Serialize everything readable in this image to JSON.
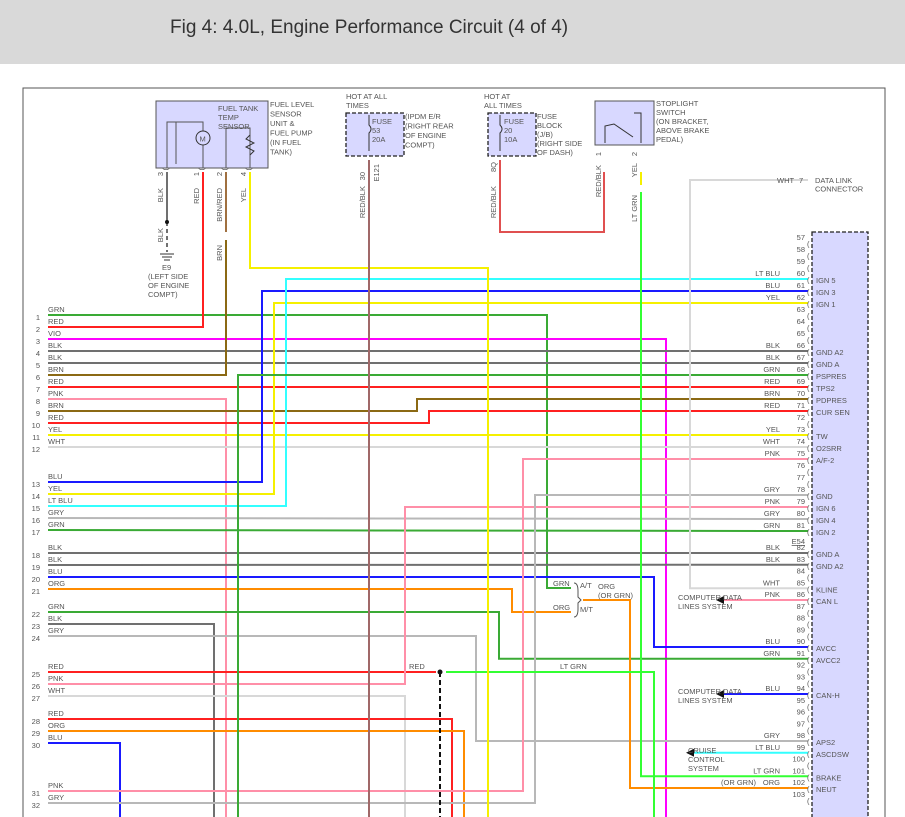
{
  "title": "Fig 4: 4.0L, Engine Performance Circuit (4 of 4)",
  "colors": {
    "GRN": "#3aaa35",
    "RED": "#ff2020",
    "VIO": "#ff00ff",
    "BLK": "#707070",
    "BRN": "#8b6914",
    "PNK": "#ff8fa8",
    "YEL": "#f5f000",
    "WHT": "#d8d8d8",
    "BLU": "#1a1aff",
    "LT BLU": "#33ffff",
    "GRY": "#b8b8b8",
    "ORG": "#ff8c00",
    "LT GRN": "#33ff33",
    "RED/BLK": "#a06868",
    "component_fill": "#d8d8ff"
  },
  "fuel_sensor": {
    "inner_label": [
      "FUEL TANK",
      "TEMP",
      "SENSOR"
    ],
    "label": [
      "FUEL LEVEL",
      "SENSOR",
      "UNIT &",
      "FUEL PUMP",
      "(IN FUEL",
      "TANK)"
    ],
    "motor_symbol": "M",
    "pins": [
      {
        "num": "3",
        "wire": "BLK"
      },
      {
        "num": "1",
        "wire": "RED"
      },
      {
        "num": "2",
        "wire": "BRN/RED"
      },
      {
        "num": "4",
        "wire": "YEL"
      }
    ],
    "brn_after_connector": "BRN",
    "blk_after_splice": "BLK",
    "ground_id": "E9",
    "ground_label": [
      "(LEFT SIDE",
      "OF ENGINE",
      "COMPT)"
    ]
  },
  "fuse53": {
    "hot": [
      "HOT AT ALL",
      "TIMES"
    ],
    "fuse": [
      "FUSE",
      "53",
      "20A"
    ],
    "label": [
      "(IPDM E/R",
      "(RIGHT REAR",
      "OF ENGINE",
      "COMPT)"
    ],
    "pin": "30",
    "wire": "RED/BLK",
    "connector": "E121"
  },
  "fuse20": {
    "hot": [
      "HOT AT",
      "ALL TIMES"
    ],
    "fuse": [
      "FUSE",
      "20",
      "10A"
    ],
    "label": [
      "FUSE",
      "BLOCK",
      "(J/B)",
      "(RIGHT SIDE",
      "OF DASH)"
    ],
    "pin": "8Q",
    "wire": "RED/BLK"
  },
  "stoplight": {
    "label": [
      "STOPLIGHT",
      "SWITCH",
      "(ON BRACKET,",
      "ABOVE BRAKE",
      "PEDAL)"
    ],
    "pins": [
      {
        "num": "1",
        "wire": "RED/BLK"
      },
      {
        "num": "2",
        "wire": "YEL"
      }
    ],
    "wire_after_connector": "LT GRN"
  },
  "data_link": {
    "wire": "WHT",
    "pin": "7",
    "label": [
      "DATA LINK",
      "CONNECTOR"
    ]
  },
  "left_pins": [
    {
      "num": "1",
      "wire": "GRN"
    },
    {
      "num": "2",
      "wire": "RED"
    },
    {
      "num": "3",
      "wire": "VIO"
    },
    {
      "num": "4",
      "wire": "BLK"
    },
    {
      "num": "5",
      "wire": "BLK"
    },
    {
      "num": "6",
      "wire": "BRN"
    },
    {
      "num": "7",
      "wire": "RED"
    },
    {
      "num": "8",
      "wire": "PNK"
    },
    {
      "num": "9",
      "wire": "BRN"
    },
    {
      "num": "10",
      "wire": "RED"
    },
    {
      "num": "11",
      "wire": "YEL"
    },
    {
      "num": "12",
      "wire": "WHT"
    },
    {
      "num": "13",
      "wire": "BLU"
    },
    {
      "num": "14",
      "wire": "YEL"
    },
    {
      "num": "15",
      "wire": "LT BLU"
    },
    {
      "num": "16",
      "wire": "GRY"
    },
    {
      "num": "17",
      "wire": "GRN"
    },
    {
      "num": "18",
      "wire": "BLK"
    },
    {
      "num": "19",
      "wire": "BLK"
    },
    {
      "num": "20",
      "wire": "BLU"
    },
    {
      "num": "21",
      "wire": "ORG"
    },
    {
      "num": "22",
      "wire": "GRN"
    },
    {
      "num": "23",
      "wire": "BLK"
    },
    {
      "num": "24",
      "wire": "GRY"
    },
    {
      "num": "25",
      "wire": "RED"
    },
    {
      "num": "26",
      "wire": "PNK"
    },
    {
      "num": "27",
      "wire": "WHT"
    },
    {
      "num": "28",
      "wire": "RED"
    },
    {
      "num": "29",
      "wire": "ORG"
    },
    {
      "num": "30",
      "wire": "BLU"
    },
    {
      "num": "31",
      "wire": "PNK"
    },
    {
      "num": "32",
      "wire": "GRY"
    }
  ],
  "ecm_connector_id": "E54",
  "right_pins": [
    {
      "num": "57"
    },
    {
      "num": "58"
    },
    {
      "num": "59"
    },
    {
      "num": "60",
      "wire": "LT BLU",
      "func": "IGN 5"
    },
    {
      "num": "61",
      "wire": "BLU",
      "func": "IGN 3"
    },
    {
      "num": "62",
      "wire": "YEL",
      "func": "IGN 1"
    },
    {
      "num": "63"
    },
    {
      "num": "64"
    },
    {
      "num": "65"
    },
    {
      "num": "66",
      "wire": "BLK",
      "func": "GND A2"
    },
    {
      "num": "67",
      "wire": "BLK",
      "func": "GND A"
    },
    {
      "num": "68",
      "wire": "GRN",
      "func": "PSPRES"
    },
    {
      "num": "69",
      "wire": "RED",
      "func": "TPS2"
    },
    {
      "num": "70",
      "wire": "BRN",
      "func": "PDPRES"
    },
    {
      "num": "71",
      "wire": "RED",
      "func": "CUR SEN"
    },
    {
      "num": "72"
    },
    {
      "num": "73",
      "wire": "YEL",
      "func": "TW"
    },
    {
      "num": "74",
      "wire": "WHT",
      "func": "O2SRR"
    },
    {
      "num": "75",
      "wire": "PNK",
      "func": "A/F-2"
    },
    {
      "num": "76"
    },
    {
      "num": "77"
    },
    {
      "num": "78",
      "wire": "GRY",
      "func": "GND"
    },
    {
      "num": "79",
      "wire": "PNK",
      "func": "IGN 6"
    },
    {
      "num": "80",
      "wire": "GRY",
      "func": "IGN 4"
    },
    {
      "num": "81",
      "wire": "GRN",
      "func": "IGN 2"
    },
    {
      "num": "82",
      "wire": "BLK",
      "func": "GND A"
    },
    {
      "num": "83",
      "wire": "BLK",
      "func": "GND A2"
    },
    {
      "num": "84"
    },
    {
      "num": "85",
      "wire": "WHT",
      "func": "KLINE"
    },
    {
      "num": "86",
      "wire": "PNK",
      "func": "CAN L"
    },
    {
      "num": "87"
    },
    {
      "num": "88"
    },
    {
      "num": "89"
    },
    {
      "num": "90",
      "wire": "BLU",
      "func": "AVCC"
    },
    {
      "num": "91",
      "wire": "GRN",
      "func": "AVCC2"
    },
    {
      "num": "92"
    },
    {
      "num": "93"
    },
    {
      "num": "94",
      "wire": "BLU",
      "func": "CAN-H"
    },
    {
      "num": "95"
    },
    {
      "num": "96"
    },
    {
      "num": "97"
    },
    {
      "num": "98",
      "wire": "GRY",
      "func": "APS2"
    },
    {
      "num": "99",
      "wire": "LT BLU",
      "func": "ASCDSW"
    },
    {
      "num": "100"
    },
    {
      "num": "101",
      "wire": "LT GRN",
      "func": "BRAKE"
    },
    {
      "num": "102",
      "wire": "ORG",
      "wire_note": "(OR GRN)",
      "func": "NEUT"
    },
    {
      "num": "103"
    }
  ],
  "annotations": {
    "computer_data_1": [
      "COMPUTER DATA",
      "LINES SYSTEM"
    ],
    "computer_data_2": [
      "COMPUTER DATA",
      "LINES SYSTEM"
    ],
    "cruise": [
      "CRUISE",
      "CONTROL",
      "SYSTEM"
    ],
    "at_wire": "GRN",
    "at": "A/T",
    "mt_wire": "ORG",
    "mt": "M/T",
    "trans_out": [
      "ORG",
      "(OR GRN)"
    ],
    "red_splice": "RED",
    "lt_grn_splice": "LT GRN"
  }
}
